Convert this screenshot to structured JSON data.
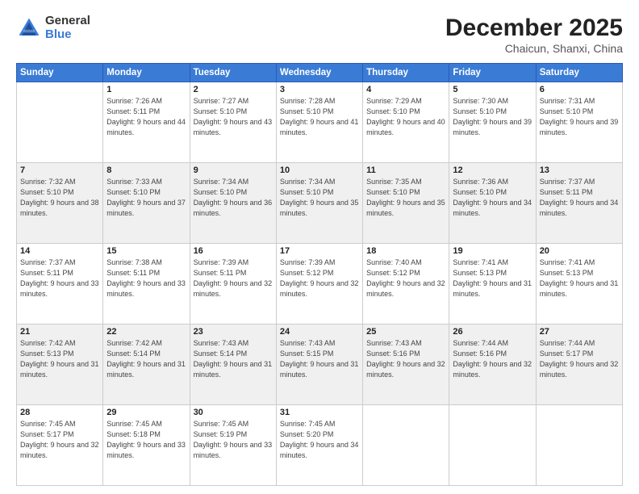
{
  "header": {
    "logo_general": "General",
    "logo_blue": "Blue",
    "month_title": "December 2025",
    "location": "Chaicun, Shanxi, China"
  },
  "weekdays": [
    "Sunday",
    "Monday",
    "Tuesday",
    "Wednesday",
    "Thursday",
    "Friday",
    "Saturday"
  ],
  "weeks": [
    [
      {
        "day": "",
        "content": ""
      },
      {
        "day": "1",
        "content": "Sunrise: 7:26 AM\nSunset: 5:11 PM\nDaylight: 9 hours\nand 44 minutes."
      },
      {
        "day": "2",
        "content": "Sunrise: 7:27 AM\nSunset: 5:10 PM\nDaylight: 9 hours\nand 43 minutes."
      },
      {
        "day": "3",
        "content": "Sunrise: 7:28 AM\nSunset: 5:10 PM\nDaylight: 9 hours\nand 41 minutes."
      },
      {
        "day": "4",
        "content": "Sunrise: 7:29 AM\nSunset: 5:10 PM\nDaylight: 9 hours\nand 40 minutes."
      },
      {
        "day": "5",
        "content": "Sunrise: 7:30 AM\nSunset: 5:10 PM\nDaylight: 9 hours\nand 39 minutes."
      },
      {
        "day": "6",
        "content": "Sunrise: 7:31 AM\nSunset: 5:10 PM\nDaylight: 9 hours\nand 39 minutes."
      }
    ],
    [
      {
        "day": "7",
        "content": "Sunrise: 7:32 AM\nSunset: 5:10 PM\nDaylight: 9 hours\nand 38 minutes."
      },
      {
        "day": "8",
        "content": "Sunrise: 7:33 AM\nSunset: 5:10 PM\nDaylight: 9 hours\nand 37 minutes."
      },
      {
        "day": "9",
        "content": "Sunrise: 7:34 AM\nSunset: 5:10 PM\nDaylight: 9 hours\nand 36 minutes."
      },
      {
        "day": "10",
        "content": "Sunrise: 7:34 AM\nSunset: 5:10 PM\nDaylight: 9 hours\nand 35 minutes."
      },
      {
        "day": "11",
        "content": "Sunrise: 7:35 AM\nSunset: 5:10 PM\nDaylight: 9 hours\nand 35 minutes."
      },
      {
        "day": "12",
        "content": "Sunrise: 7:36 AM\nSunset: 5:10 PM\nDaylight: 9 hours\nand 34 minutes."
      },
      {
        "day": "13",
        "content": "Sunrise: 7:37 AM\nSunset: 5:11 PM\nDaylight: 9 hours\nand 34 minutes."
      }
    ],
    [
      {
        "day": "14",
        "content": "Sunrise: 7:37 AM\nSunset: 5:11 PM\nDaylight: 9 hours\nand 33 minutes."
      },
      {
        "day": "15",
        "content": "Sunrise: 7:38 AM\nSunset: 5:11 PM\nDaylight: 9 hours\nand 33 minutes."
      },
      {
        "day": "16",
        "content": "Sunrise: 7:39 AM\nSunset: 5:11 PM\nDaylight: 9 hours\nand 32 minutes."
      },
      {
        "day": "17",
        "content": "Sunrise: 7:39 AM\nSunset: 5:12 PM\nDaylight: 9 hours\nand 32 minutes."
      },
      {
        "day": "18",
        "content": "Sunrise: 7:40 AM\nSunset: 5:12 PM\nDaylight: 9 hours\nand 32 minutes."
      },
      {
        "day": "19",
        "content": "Sunrise: 7:41 AM\nSunset: 5:13 PM\nDaylight: 9 hours\nand 31 minutes."
      },
      {
        "day": "20",
        "content": "Sunrise: 7:41 AM\nSunset: 5:13 PM\nDaylight: 9 hours\nand 31 minutes."
      }
    ],
    [
      {
        "day": "21",
        "content": "Sunrise: 7:42 AM\nSunset: 5:13 PM\nDaylight: 9 hours\nand 31 minutes."
      },
      {
        "day": "22",
        "content": "Sunrise: 7:42 AM\nSunset: 5:14 PM\nDaylight: 9 hours\nand 31 minutes."
      },
      {
        "day": "23",
        "content": "Sunrise: 7:43 AM\nSunset: 5:14 PM\nDaylight: 9 hours\nand 31 minutes."
      },
      {
        "day": "24",
        "content": "Sunrise: 7:43 AM\nSunset: 5:15 PM\nDaylight: 9 hours\nand 31 minutes."
      },
      {
        "day": "25",
        "content": "Sunrise: 7:43 AM\nSunset: 5:16 PM\nDaylight: 9 hours\nand 32 minutes."
      },
      {
        "day": "26",
        "content": "Sunrise: 7:44 AM\nSunset: 5:16 PM\nDaylight: 9 hours\nand 32 minutes."
      },
      {
        "day": "27",
        "content": "Sunrise: 7:44 AM\nSunset: 5:17 PM\nDaylight: 9 hours\nand 32 minutes."
      }
    ],
    [
      {
        "day": "28",
        "content": "Sunrise: 7:45 AM\nSunset: 5:17 PM\nDaylight: 9 hours\nand 32 minutes."
      },
      {
        "day": "29",
        "content": "Sunrise: 7:45 AM\nSunset: 5:18 PM\nDaylight: 9 hours\nand 33 minutes."
      },
      {
        "day": "30",
        "content": "Sunrise: 7:45 AM\nSunset: 5:19 PM\nDaylight: 9 hours\nand 33 minutes."
      },
      {
        "day": "31",
        "content": "Sunrise: 7:45 AM\nSunset: 5:20 PM\nDaylight: 9 hours\nand 34 minutes."
      },
      {
        "day": "",
        "content": ""
      },
      {
        "day": "",
        "content": ""
      },
      {
        "day": "",
        "content": ""
      }
    ]
  ]
}
